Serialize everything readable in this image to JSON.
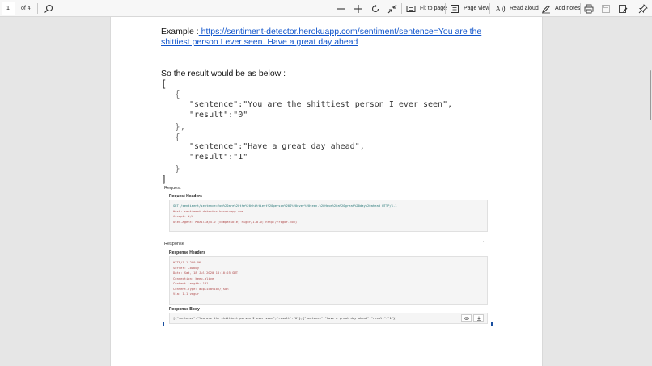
{
  "toolbar": {
    "page_number": "1",
    "page_count": "of 4",
    "fit_to_page": "Fit to page",
    "page_view": "Page view",
    "read_aloud": "Read aloud",
    "add_notes": "Add notes"
  },
  "content": {
    "example_label": "Example  :",
    "example_url": " https://sentiment-detector.herokuapp.com/sentiment/sentence=You are the shittiest person I ever seen. Have a great day ahead",
    "result_text": "So the result would be as below :",
    "json_lines": {
      "open_bracket": "[",
      "brace1_open": "{",
      "sentence1": "\"sentence\":\"You are the shittiest person I ever seen\",",
      "result1": "\"result\":\"0\"",
      "brace1_close": "},",
      "brace2_open": "{",
      "sentence2": "\"sentence\":\"Have a great day ahead\",",
      "result2": "\"result\":\"1\"",
      "brace2_close": "}",
      "close_bracket": "]"
    }
  },
  "api": {
    "request_title": "Request",
    "request_headers_label": "Request Headers",
    "request_lines": [
      "GET /sentiment/sentence=You%20are%20the%20shittiest%20person%20I%20ever%20seen.%20Have%20a%20great%20day%20ahead HTTP/1.1",
      "Host: sentiment-detector.herokuapp.com",
      "Accept: */*",
      "User-Agent: Mozilla/5.0 (compatible; Rigor/1.0.0; http://rigor.com)"
    ],
    "response_title": "Response",
    "response_headers_label": "Response Headers",
    "response_lines": [
      "HTTP/1.1 200 OK",
      "Server: Cowboy",
      "Date: Sat, 18 Jul 2020 18:10:25 GMT",
      "Connection: keep-alive",
      "Content-Length: 131",
      "Content-Type: application/json",
      "Via: 1.1 vegur"
    ],
    "response_body_label": "Response Body",
    "response_body": "[{\"sentence\":\"You are the shittiest person I ever seen\",\"result\":\"0\"},{\"sentence\":\"Have a great day ahead\",\"result\":\"1\"}]"
  },
  "icons": [
    "search-icon",
    "zoom-out-icon",
    "zoom-in-icon",
    "rotate-icon",
    "fit-icon",
    "fit-page-icon",
    "page-view-icon",
    "read-aloud-icon",
    "add-notes-icon",
    "print-icon",
    "save-icon",
    "save-as-icon",
    "pin-icon"
  ]
}
